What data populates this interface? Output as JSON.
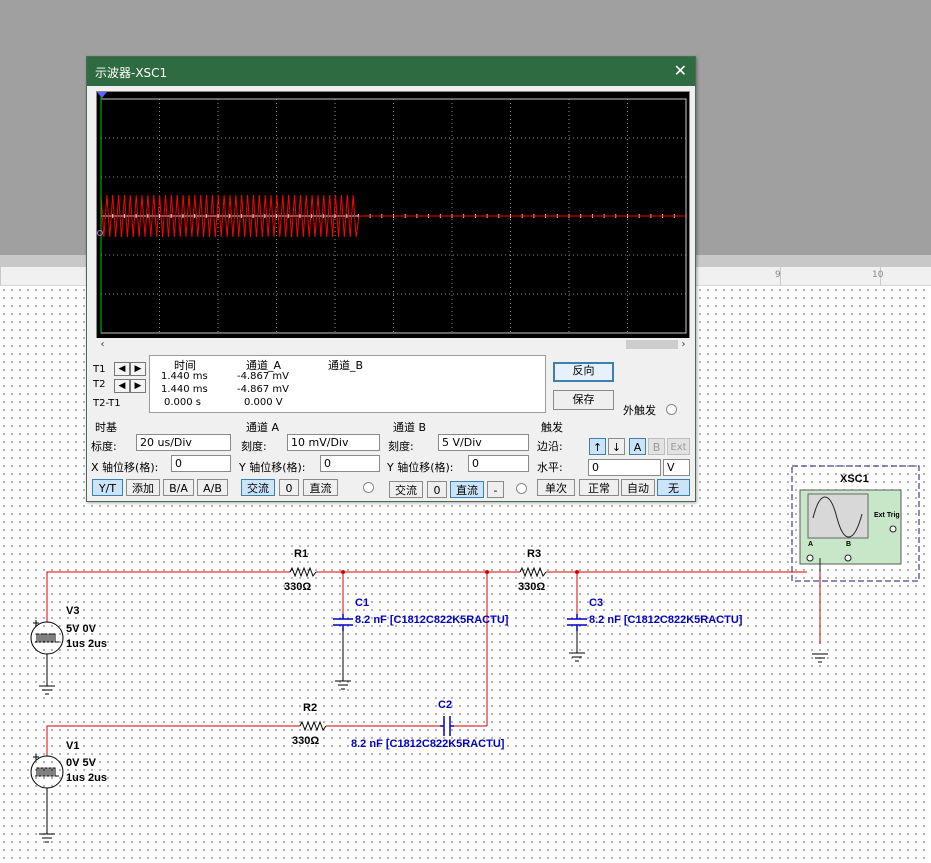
{
  "oscilloscope": {
    "title": "示波器-XSC1",
    "cursor": {
      "row_t1": "T1",
      "row_t2": "T2",
      "row_diff": "T2-T1",
      "col_time": "时间",
      "col_a": "通道_A",
      "col_b": "通道_B",
      "t1_time": "1.440 ms",
      "t1_a": "-4.867 mV",
      "t2_time": "1.440 ms",
      "t2_a": "-4.867 mV",
      "diff_time": "0.000 s",
      "diff_a": "0.000 V"
    },
    "buttons": {
      "reverse": "反向",
      "save": "保存",
      "ext_trigger": "外触发"
    },
    "timebase": {
      "title": "时基",
      "scale_label": "标度:",
      "scale_value": "20 us/Div",
      "xpos_label": "X 轴位移(格):",
      "xpos_value": "0",
      "mode_yt": "Y/T",
      "mode_add": "添加",
      "mode_ba": "B/A",
      "mode_ab": "A/B"
    },
    "channel_a": {
      "title": "通道 A",
      "scale_label": "刻度:",
      "scale_value": "10 mV/Div",
      "ypos_label": "Y 轴位移(格):",
      "ypos_value": "0",
      "ac": "交流",
      "zero": "0",
      "dc": "直流"
    },
    "channel_b": {
      "title": "通道 B",
      "scale_label": "刻度:",
      "scale_value": "5  V/Div",
      "ypos_label": "Y 轴位移(格):",
      "ypos_value": "0",
      "ac": "交流",
      "zero": "0",
      "dc": "直流",
      "minus": "-"
    },
    "trigger": {
      "title": "触发",
      "edge_label": "边沿:",
      "src_a": "A",
      "src_b": "B",
      "src_ext": "Ext",
      "level_label": "水平:",
      "level_value": "0",
      "level_unit": "V",
      "single": "单次",
      "normal": "正常",
      "auto": "自动",
      "none": "无"
    },
    "trace_color": "#ff0000"
  },
  "ruler": {
    "marks": [
      "9",
      "10"
    ]
  },
  "circuit": {
    "instrument": {
      "name": "XSC1",
      "ext_trig": "Ext Trig",
      "ch_a": "A",
      "ch_b": "B"
    },
    "R1": {
      "name": "R1",
      "value": "330Ω"
    },
    "R2": {
      "name": "R2",
      "value": "330Ω"
    },
    "R3": {
      "name": "R3",
      "value": "330Ω"
    },
    "C1": {
      "name": "C1",
      "value": "8.2 nF  [C1812C822K5RACTU]"
    },
    "C2": {
      "name": "C2",
      "value": "8.2 nF  [C1812C822K5RACTU]"
    },
    "C3": {
      "name": "C3",
      "value": "8.2 nF  [C1812C822K5RACTU]"
    },
    "V3": {
      "name": "V3",
      "levels": "5V 0V",
      "timing": "1us 2us"
    },
    "V1": {
      "name": "V1",
      "levels": "0V 5V",
      "timing": "1us 2us"
    },
    "wire_color": "#d40000",
    "label_color": "#0000c8"
  }
}
